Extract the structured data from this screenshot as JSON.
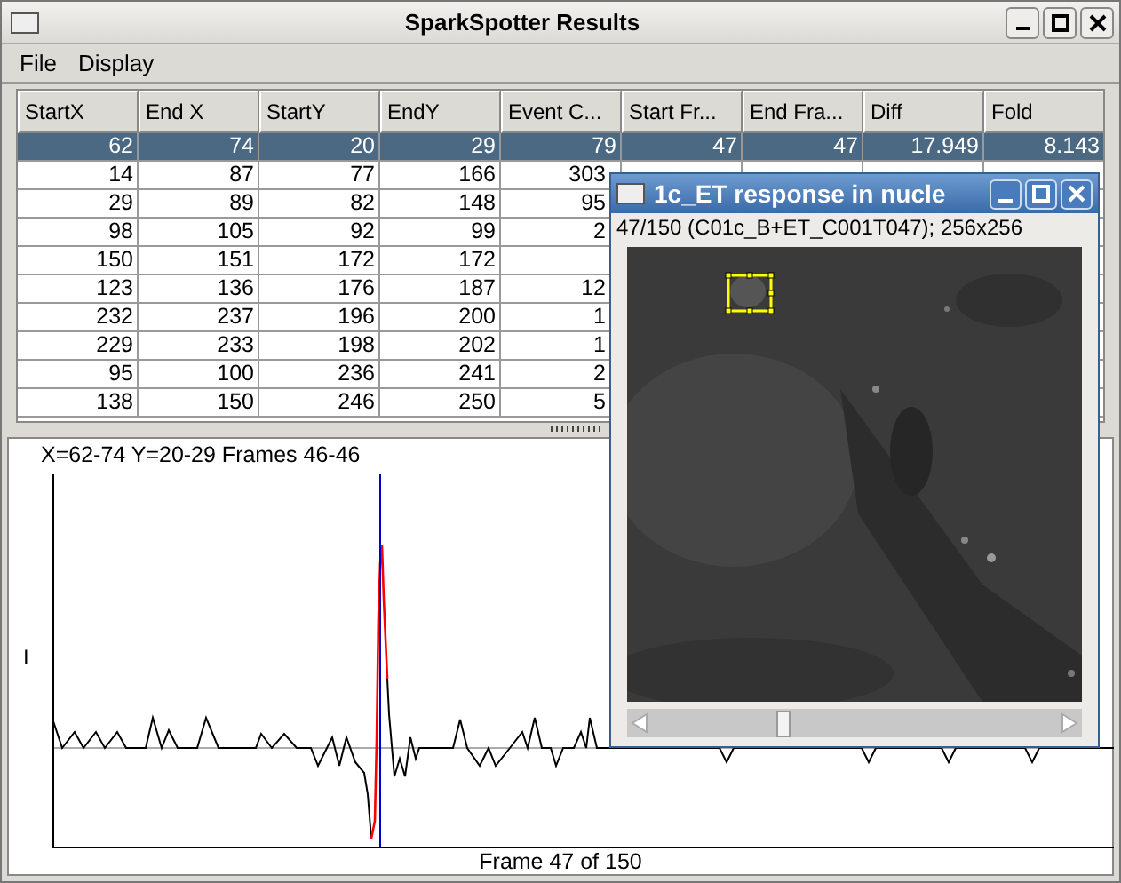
{
  "window": {
    "title": "SparkSpotter Results"
  },
  "menu": [
    "File",
    "Display"
  ],
  "table": {
    "columns": [
      "StartX",
      "End X",
      "StartY",
      "EndY",
      "Event C...",
      "Start Fr...",
      "End Fra...",
      "Diff",
      "Fold"
    ],
    "rows": [
      {
        "selected": true,
        "cells": [
          "62",
          "74",
          "20",
          "29",
          "79",
          "47",
          "47",
          "17.949",
          "8.143"
        ]
      },
      {
        "selected": false,
        "cells": [
          "14",
          "87",
          "77",
          "166",
          "303"
        ]
      },
      {
        "selected": false,
        "cells": [
          "29",
          "89",
          "82",
          "148",
          "95"
        ]
      },
      {
        "selected": false,
        "cells": [
          "98",
          "105",
          "92",
          "99",
          "2"
        ]
      },
      {
        "selected": false,
        "cells": [
          "150",
          "151",
          "172",
          "172",
          ""
        ]
      },
      {
        "selected": false,
        "cells": [
          "123",
          "136",
          "176",
          "187",
          "12"
        ]
      },
      {
        "selected": false,
        "cells": [
          "232",
          "237",
          "196",
          "200",
          "1"
        ]
      },
      {
        "selected": false,
        "cells": [
          "229",
          "233",
          "198",
          "202",
          "1"
        ]
      },
      {
        "selected": false,
        "cells": [
          "95",
          "100",
          "236",
          "241",
          "2"
        ]
      },
      {
        "selected": false,
        "cells": [
          "138",
          "150",
          "246",
          "250",
          "5"
        ]
      }
    ]
  },
  "plot": {
    "caption": "X=62-74 Y=20-29 Frames 46-46",
    "axis_label": "I",
    "footer": "Frame 47 of 150"
  },
  "image_window": {
    "title": "1c_ET response in nucle",
    "info": "47/150 (C01c_B+ET_C001T047); 256x256"
  }
}
